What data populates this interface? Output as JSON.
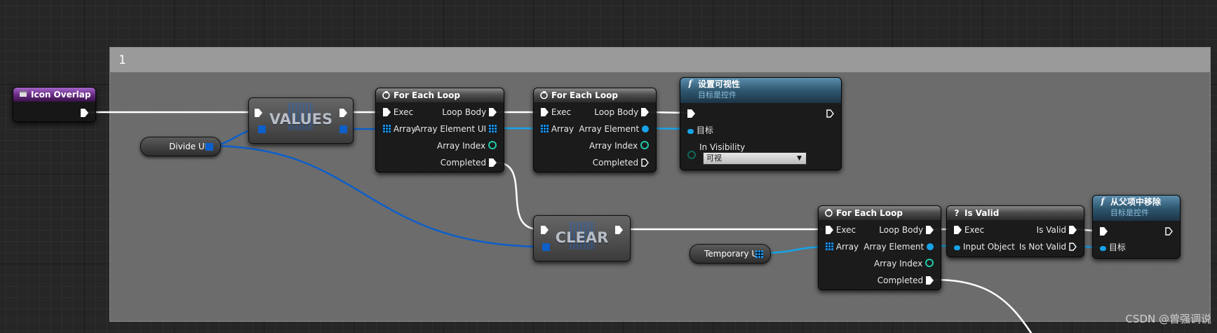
{
  "comment": {
    "title": "1"
  },
  "nodes": {
    "icon_overlap": {
      "title": "Icon Overlap"
    },
    "divide_ui": {
      "label": "Divide UI"
    },
    "values": {
      "label": "VALUES"
    },
    "for_each_1": {
      "title": "For Each Loop",
      "exec": "Exec",
      "array": "Array",
      "loop_body": "Loop Body",
      "array_element": "Array Element UI",
      "array_index": "Array Index",
      "completed": "Completed"
    },
    "for_each_2": {
      "title": "For Each Loop",
      "exec": "Exec",
      "array": "Array",
      "loop_body": "Loop Body",
      "array_element": "Array Element",
      "array_index": "Array Index",
      "completed": "Completed"
    },
    "set_visibility": {
      "title": "设置可视性",
      "subtitle": "目标是控件",
      "target": "目标",
      "in_visibility": "In Visibility",
      "visibility_value": "可视"
    },
    "clear": {
      "label": "CLEAR"
    },
    "temporary_ui": {
      "label": "Temporary UI"
    },
    "for_each_3": {
      "title": "For Each Loop",
      "exec": "Exec",
      "array": "Array",
      "loop_body": "Loop Body",
      "array_element": "Array Element",
      "array_index": "Array Index",
      "completed": "Completed"
    },
    "is_valid": {
      "title": "Is Valid",
      "exec": "Exec",
      "input_object": "Input Object",
      "is_valid": "Is Valid",
      "is_not_valid": "Is Not Valid"
    },
    "remove_from_parent": {
      "title": "从父项中移除",
      "subtitle": "目标是控件",
      "target": "目标"
    }
  },
  "icons": {
    "event": "event-icon",
    "loop": "loop-icon",
    "function": "function-icon",
    "question": "question-icon"
  },
  "colors": {
    "exec_wire": "#ffffff",
    "object_wire": "#16a3e8",
    "array_wire": "#0d5fc9",
    "event_header": "#6a2c85",
    "function_header": "#2f5870",
    "integer_pin": "#1cc9a9"
  },
  "watermark": "CSDN @曾强调说"
}
